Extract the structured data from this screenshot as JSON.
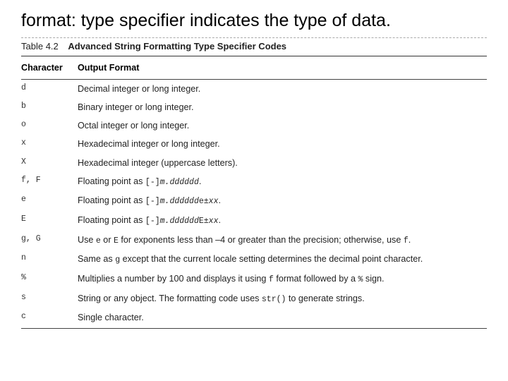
{
  "intro": "format: type specifier indicates the type of data.",
  "table_label": "Table 4.2",
  "table_title": "Advanced String Formatting Type Specifier Codes",
  "headers": {
    "c0": "Character",
    "c1": "Output Format"
  },
  "rows": [
    {
      "ch": "d",
      "desc_html": "Decimal integer or long integer."
    },
    {
      "ch": "b",
      "desc_html": "Binary integer or long integer."
    },
    {
      "ch": "o",
      "desc_html": "Octal integer or long integer."
    },
    {
      "ch": "x",
      "desc_html": "Hexadecimal integer or long integer."
    },
    {
      "ch": "X",
      "desc_html": "Hexadecimal integer (uppercase letters)."
    },
    {
      "ch": "f, F",
      "desc_html": "Floating point as <span class=\"code\">[-]<i>m.dddddd</i></span>."
    },
    {
      "ch": "e",
      "desc_html": "Floating point as <span class=\"code\">[-]<i>m.dddddd</i>e±<i>xx</i></span>."
    },
    {
      "ch": "E",
      "desc_html": "Floating point as <span class=\"code\">[-]<i>m.dddddd</i>E±<i>xx</i></span>."
    },
    {
      "ch": "g, G",
      "desc_html": "Use <span class=\"code\">e</span> or <span class=\"code\">E</span> for exponents less than –4 or greater than the precision; otherwise, use <span class=\"code\">f</span>."
    },
    {
      "ch": "n",
      "desc_html": "Same as <span class=\"code\">g</span> except that the current locale setting determines the decimal point character."
    },
    {
      "ch": "%",
      "desc_html": "Multiplies a number by 100 and displays it using <span class=\"code\">f</span> format followed by a <span class=\"code\">%</span> sign."
    },
    {
      "ch": "s",
      "desc_html": "String or any object. The formatting code uses <span class=\"code\">str()</span> to generate strings."
    },
    {
      "ch": "c",
      "desc_html": "Single character."
    }
  ]
}
